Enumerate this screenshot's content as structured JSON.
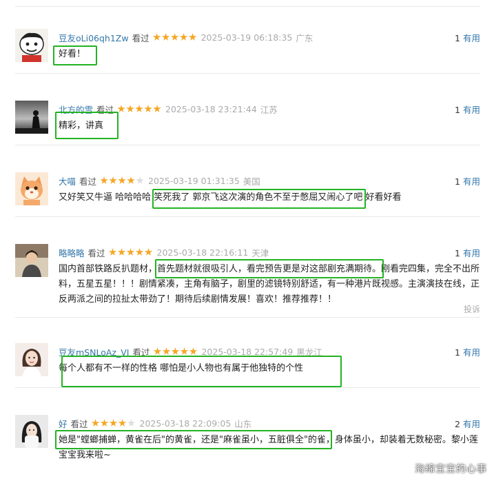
{
  "colors": {
    "star_on": "#f5a623",
    "star_off": "#dddddd",
    "highlight": "#22b322",
    "link": "#3377aa"
  },
  "reviews": [
    {
      "user": "豆友oLi06qh1Zw",
      "status": "看过",
      "rating": 5,
      "time": "2025-03-19 06:18:35",
      "location": "广东",
      "useful_count": "1",
      "useful_label": "有用",
      "content": "好看！"
    },
    {
      "user": "北方的雪",
      "status": "看过",
      "rating": 5,
      "time": "2025-03-18 23:21:44",
      "location": "江苏",
      "useful_count": "1",
      "useful_label": "有用",
      "content": "精彩，讲真"
    },
    {
      "user": "大喵",
      "status": "看过",
      "rating": 4,
      "time": "2025-03-19 01:31:35",
      "location": "美国",
      "useful_count": "1",
      "useful_label": "有用",
      "content": "又好笑又牛逼 哈哈哈哈 笑死我了 郭京飞这次演的角色不至于憋屈又闹心了吧 好看好看"
    },
    {
      "user": "略略略",
      "status": "看过",
      "rating": 5,
      "time": "2025-03-18 22:16:11",
      "location": "天津",
      "useful_count": "1",
      "useful_label": "有用",
      "content": "国内首部铁路反扒题材，首先题材就很吸引人，看完预告更是对这部剧充满期待。刚看完四集，完全不出所料，五星五星！！！剧情紧凑，主角有脑子，剧里的滤镜特别舒适，有一种港片既视感。主演演技在线，正反两派之间的拉扯太带劲了！期待后续剧情发展！喜欢！推荐推荐！！",
      "report": "投诉"
    },
    {
      "user": "豆友mSNLoAz_VI",
      "status": "看过",
      "rating": 5,
      "time": "2025-03-18 22:57:49",
      "location": "黑龙江",
      "useful_count": "1",
      "useful_label": "有用",
      "content": "每个人都有不一样的性格 哪怕是小人物也有属于他独特的个性"
    },
    {
      "user": "好",
      "status": "看过",
      "rating": 4,
      "time": "2025-03-18 22:09:05",
      "location": "山东",
      "useful_count": "2",
      "useful_label": "有用",
      "content": "她是\"螳螂捕蝉，黄雀在后\"的黄雀，还是\"麻雀虽小，五脏俱全\"的雀，身体虽小，却装着无数秘密。黎小莲宝宝我来啦~"
    }
  ],
  "watermark": "海绵宝宝的心事"
}
